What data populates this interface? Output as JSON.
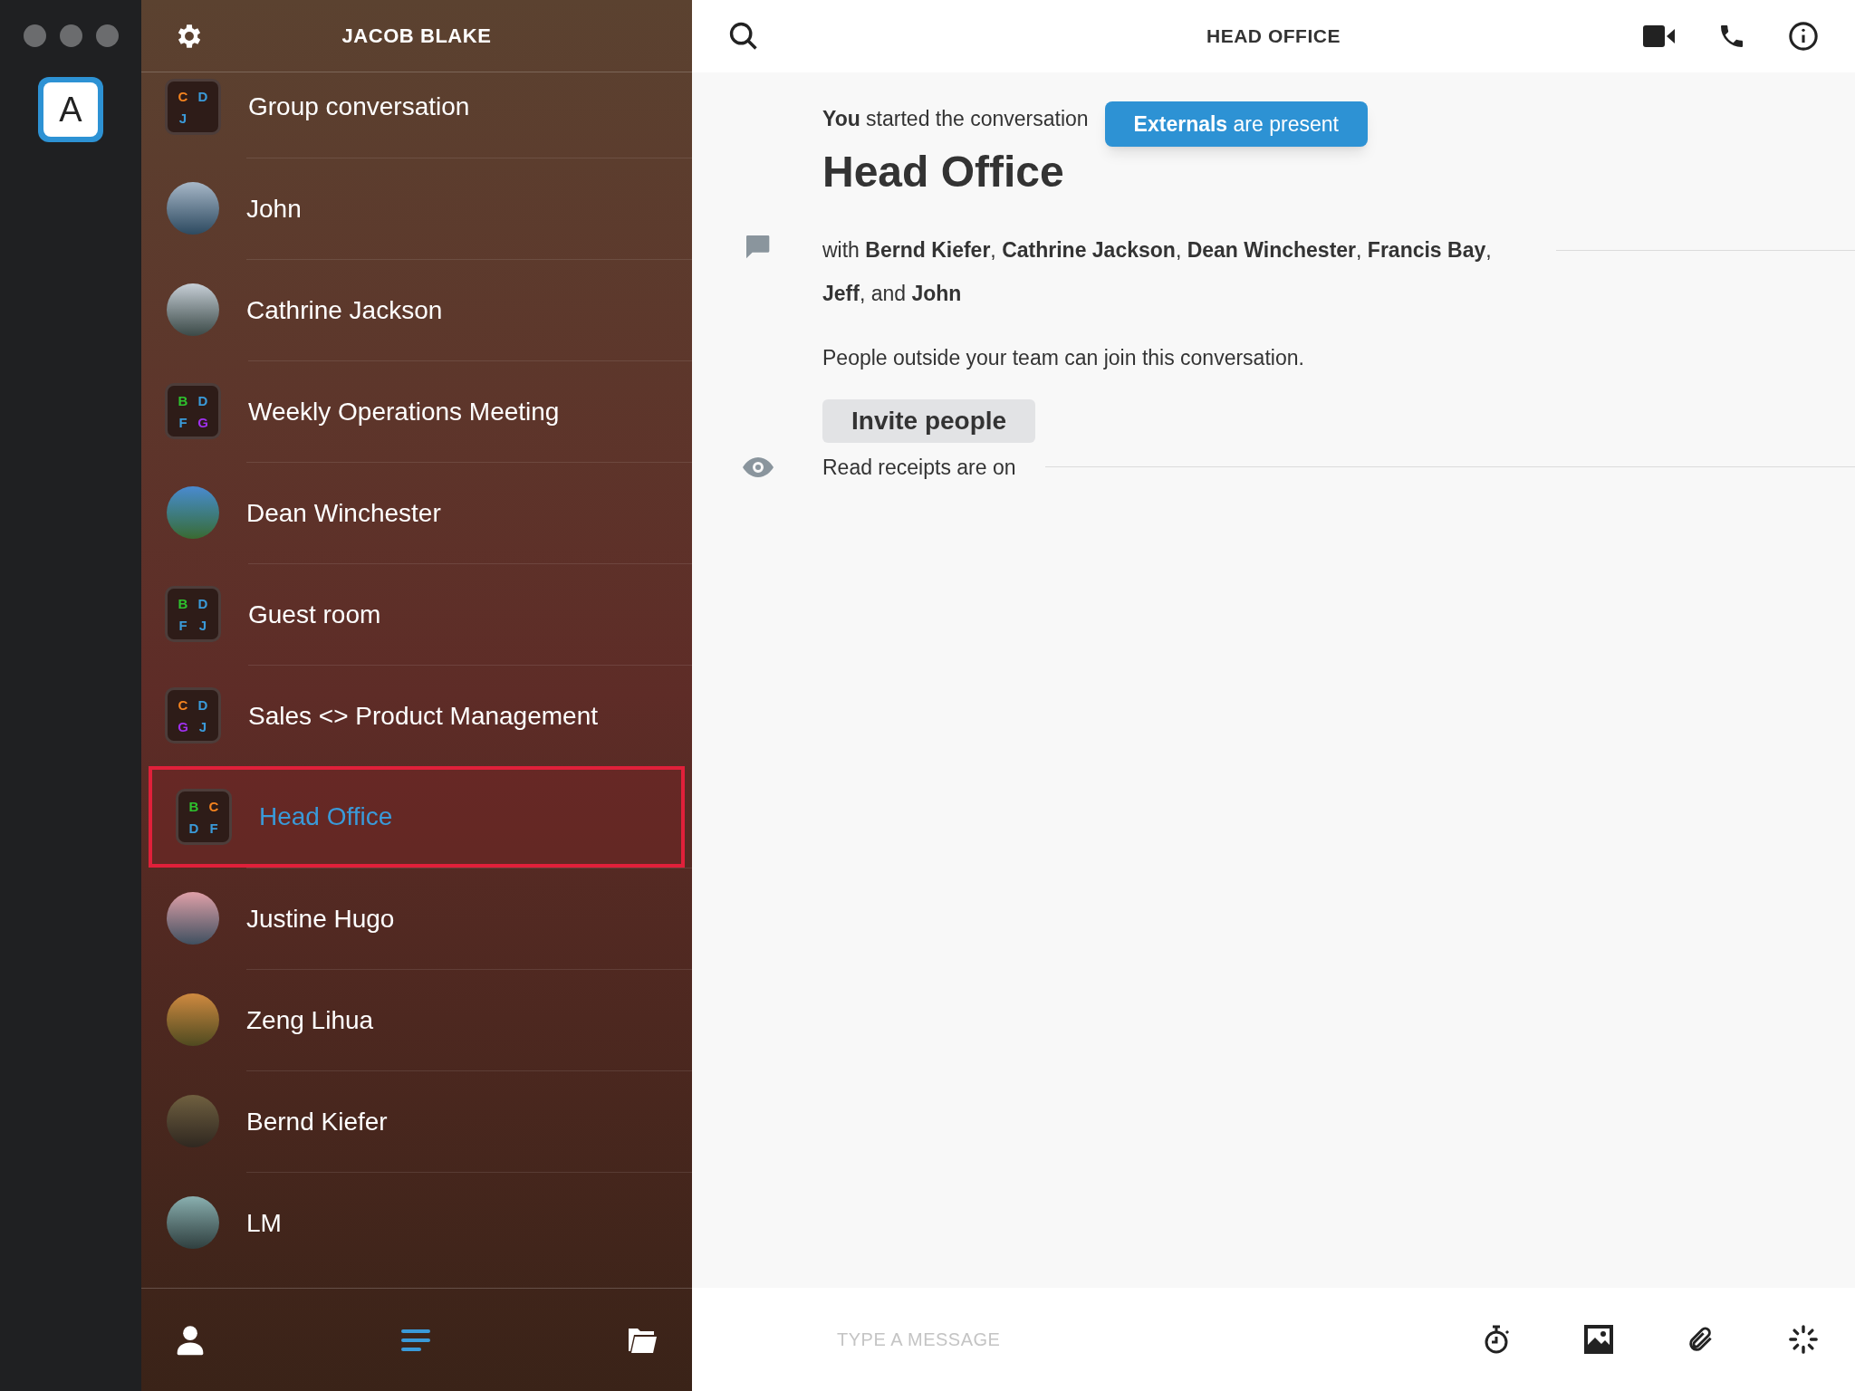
{
  "account": {
    "letter": "A",
    "selected": true
  },
  "sidebar": {
    "title": "JACOB BLAKE",
    "conversations": [
      {
        "kind": "group",
        "name": "Group conversation",
        "selected": false,
        "highlighted": false,
        "initials": [
          {
            "letter": "C",
            "color": "#f5841f"
          },
          {
            "letter": "D",
            "color": "#3a9ad9"
          },
          {
            "letter": "J",
            "color": "#3a9ad9"
          }
        ]
      },
      {
        "kind": "person",
        "name": "John",
        "selected": false,
        "highlighted": false
      },
      {
        "kind": "person",
        "name": "Cathrine Jackson",
        "selected": false,
        "highlighted": false
      },
      {
        "kind": "group",
        "name": "Weekly Operations Meeting",
        "selected": false,
        "highlighted": false,
        "initials": [
          {
            "letter": "B",
            "color": "#2ec12e"
          },
          {
            "letter": "D",
            "color": "#3a9ad9"
          },
          {
            "letter": "F",
            "color": "#3a9ad9"
          },
          {
            "letter": "G",
            "color": "#a030f0"
          }
        ]
      },
      {
        "kind": "person",
        "name": "Dean Winchester",
        "selected": false,
        "highlighted": false
      },
      {
        "kind": "group",
        "name": "Guest room",
        "selected": false,
        "highlighted": false,
        "initials": [
          {
            "letter": "B",
            "color": "#2ec12e"
          },
          {
            "letter": "D",
            "color": "#3a9ad9"
          },
          {
            "letter": "F",
            "color": "#3a9ad9"
          },
          {
            "letter": "J",
            "color": "#3a9ad9"
          }
        ]
      },
      {
        "kind": "group",
        "name": "Sales <> Product Management",
        "selected": false,
        "highlighted": false,
        "initials": [
          {
            "letter": "C",
            "color": "#f5841f"
          },
          {
            "letter": "D",
            "color": "#3a9ad9"
          },
          {
            "letter": "G",
            "color": "#a030f0"
          },
          {
            "letter": "J",
            "color": "#3a9ad9"
          }
        ]
      },
      {
        "kind": "group",
        "name": "Head Office",
        "selected": true,
        "highlighted": true,
        "initials": [
          {
            "letter": "B",
            "color": "#2ec12e"
          },
          {
            "letter": "C",
            "color": "#f5841f"
          },
          {
            "letter": "D",
            "color": "#3a9ad9"
          },
          {
            "letter": "F",
            "color": "#3a9ad9"
          }
        ]
      },
      {
        "kind": "person",
        "name": "Justine Hugo",
        "selected": false,
        "highlighted": false
      },
      {
        "kind": "person",
        "name": "Zeng Lihua",
        "selected": false,
        "highlighted": false
      },
      {
        "kind": "person",
        "name": "Bernd Kiefer",
        "selected": false,
        "highlighted": false
      },
      {
        "kind": "person",
        "name": "LM",
        "selected": false,
        "highlighted": false
      }
    ]
  },
  "conversation": {
    "title": "HEAD OFFICE",
    "started": "**You** started the conversation",
    "badge": "**Externals** are present",
    "name": "Head Office",
    "participants": "with **Bernd Kiefer**, **Cathrine Jackson**, **Dean Winchester**, **Francis Bay**, **Jeff**, and **John**",
    "notice": "People outside your team can join this conversation.",
    "invite_button": "Invite people",
    "receipts": "Read receipts are on"
  },
  "composer": {
    "placeholder": "TYPE A MESSAGE"
  }
}
